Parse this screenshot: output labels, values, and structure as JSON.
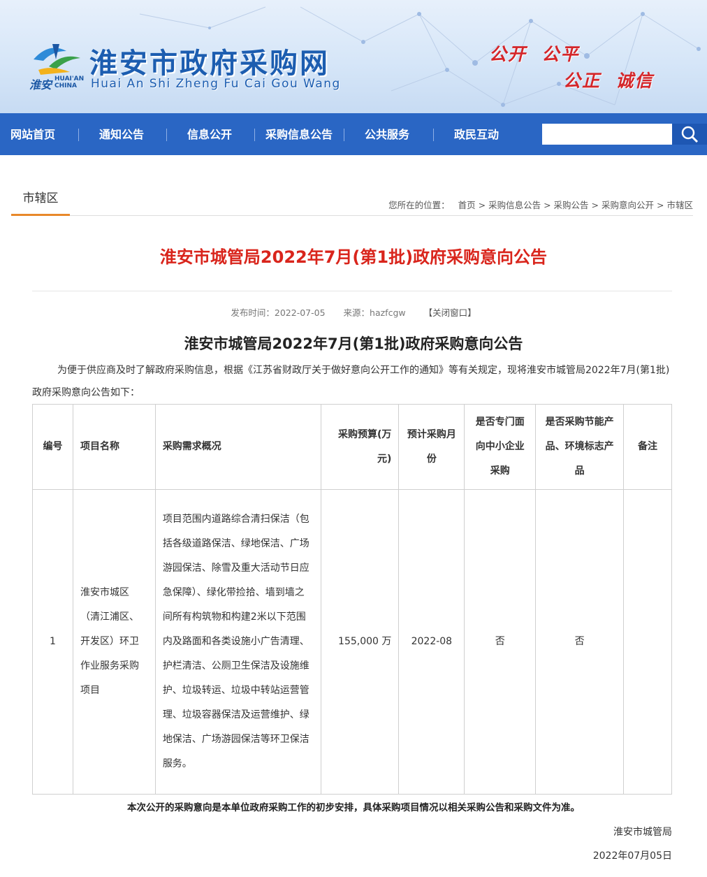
{
  "header": {
    "logo_city_cn": "淮安",
    "logo_en": "HUAI'AN CHINA",
    "site_title": "淮安市政府采购网",
    "site_pinyin": "Huai An Shi Zheng Fu Cai Gou Wang",
    "slogan_line1": "公开  公平",
    "slogan_line2": "公正  诚信"
  },
  "nav": {
    "items": [
      "网站首页",
      "通知公告",
      "信息公开",
      "采购信息公告",
      "公共服务",
      "政民互动"
    ],
    "search_placeholder": "",
    "search_value": ""
  },
  "section": {
    "tab_label": "市辖区",
    "breadcrumb_prefix": "您所在的位置：",
    "breadcrumb": [
      "首页",
      "采购信息公告",
      "采购公告",
      "采购意向公开",
      "市辖区"
    ],
    "breadcrumb_sep": ">"
  },
  "article": {
    "page_title": "淮安市城管局2022年7月(第1批)政府采购意向公告",
    "publish_label": "发布时间：2022-07-05",
    "source_label": "来源：hazfcgw",
    "close_label": "【关闭窗口】",
    "title": "淮安市城管局2022年7月(第1批)政府采购意向公告",
    "intro": "为便于供应商及时了解政府采购信息，根据《江苏省财政厅关于做好意向公开工作的通知》等有关规定，现将淮安市城管局2022年7月(第1批)政府采购意向公告如下："
  },
  "table": {
    "headers": [
      "编号",
      "项目名称",
      "采购需求概况",
      "采购预算(万元)",
      "预计采购月份",
      "是否专门面向中小企业采购",
      "是否采购节能产品、环境标志产品",
      "备注"
    ],
    "rows": [
      {
        "no": "1",
        "name": "淮安市城区（清江浦区、开发区）环卫作业服务采购项目",
        "summary": "项目范围内道路综合清扫保洁（包括各级道路保洁、绿地保洁、广场游园保洁、除雪及重大活动节日应急保障）、绿化带捡拾、墙到墙之间所有构筑物和构建2米以下范围内及路面和各类设施小广告清理、护栏清洁、公厕卫生保洁及设施维护、垃圾转运、垃圾中转站运营管理、垃圾容器保洁及运营维护、绿地保洁、广场游园保洁等环卫保洁服务。",
        "budget": "155,000 万",
        "month": "2022-08",
        "sme": "否",
        "green": "否",
        "remark": ""
      }
    ]
  },
  "footer": {
    "note": "本次公开的采购意向是本单位政府采购工作的初步安排，具体采购项目情况以相关采购公告和采购文件为准。",
    "signature": "淮安市城管局",
    "date": "2022年07月05日"
  },
  "colors": {
    "nav_bg": "#2a66c4",
    "title_red": "#d9251c",
    "tab_underline": "#e8892a",
    "brand_blue": "#1c5db0"
  }
}
